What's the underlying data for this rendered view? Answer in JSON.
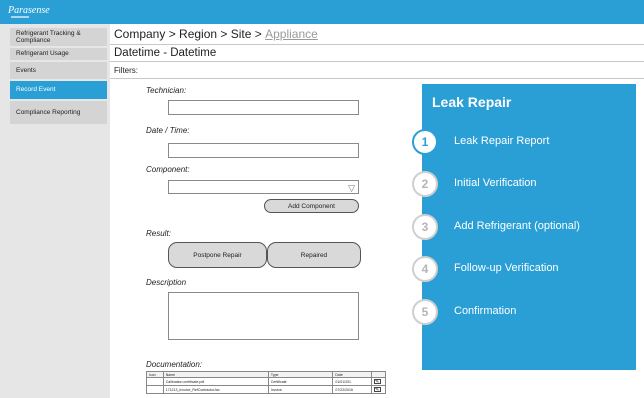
{
  "brand": {
    "logo_text": "Parasense"
  },
  "sidebar": {
    "items": [
      {
        "label": "Refrigerant Tracking & Compliance",
        "active": false
      },
      {
        "label": "Refrigerant Usage",
        "active": false
      },
      {
        "label": "Events",
        "active": false
      },
      {
        "label": "Record Event",
        "active": true
      },
      {
        "label": "Compliance Reporting",
        "active": false
      }
    ]
  },
  "breadcrumb": {
    "path": "Company > Region > Site > ",
    "current": "Appliance"
  },
  "date_range": "Datetime - Datetime",
  "filters_label": "Filters:",
  "form": {
    "technician_label": "Technician:",
    "technician_value": "",
    "datetime_label": "Date / Time:",
    "datetime_value": "",
    "component_label": "Component:",
    "component_value": "",
    "add_component_label": "Add Component",
    "result_label": "Result:",
    "postpone_label": "Postpone Repair",
    "repaired_label": "Repaired",
    "description_label": "Description",
    "description_value": "",
    "documentation_label": "Documentation:"
  },
  "documentation": {
    "columns": [
      "Icon",
      "Name",
      "Type",
      "Date",
      ""
    ],
    "rows": [
      {
        "icon": "",
        "name": "Calibration certificate.pdf",
        "type": "Certificate",
        "date": "01/01/201"
      },
      {
        "icon": "",
        "name": "171213_Invoice_RefContractorJax",
        "type": "Invoice",
        "date": "07/22/2016"
      }
    ]
  },
  "panel": {
    "title": "Leak Repair",
    "steps": [
      {
        "num": "1",
        "label": "Leak Repair Report",
        "current": true
      },
      {
        "num": "2",
        "label": "Initial Verification",
        "current": false
      },
      {
        "num": "3",
        "label": "Add Refrigerant (optional)",
        "current": false
      },
      {
        "num": "4",
        "label": "Follow-up Verification",
        "current": false
      },
      {
        "num": "5",
        "label": "Confirmation",
        "current": false
      }
    ]
  },
  "icons": {
    "dropdown": "chevron-down-icon",
    "edit": "edit-icon"
  },
  "colors": {
    "accent": "#2a9fd6",
    "sidebar_bg": "#e6e6e6",
    "sidebar_item": "#d4d4d4"
  }
}
